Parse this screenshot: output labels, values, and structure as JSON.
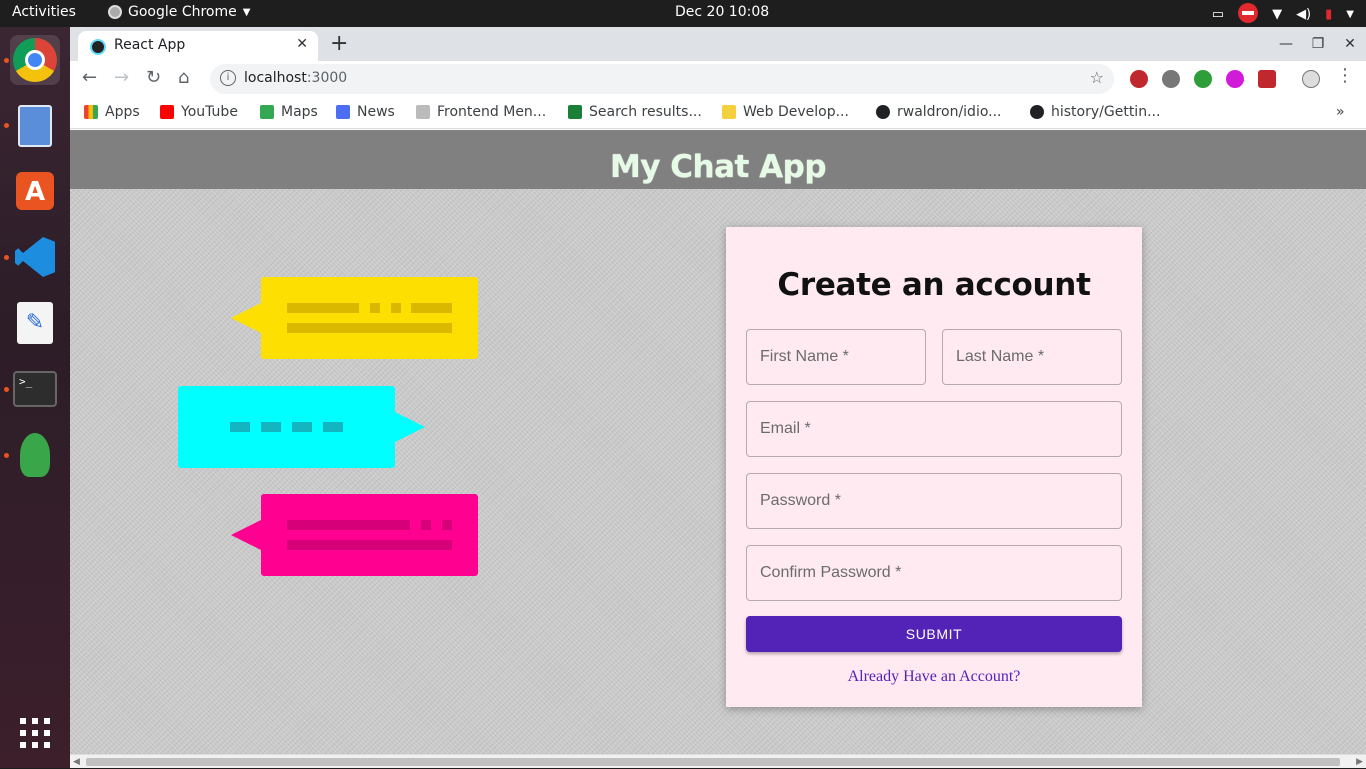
{
  "os": {
    "activities": "Activities",
    "app_name": "Google Chrome",
    "clock": "Dec 20  10:08"
  },
  "browser": {
    "tab_title": "React App",
    "url_host": "localhost",
    "url_port": ":3000",
    "bookmarks": [
      {
        "label": "Apps",
        "color": "#4285f4"
      },
      {
        "label": "YouTube",
        "color": "#ff0000"
      },
      {
        "label": "Maps",
        "color": "#34a853"
      },
      {
        "label": "News",
        "color": "#4c6ef5"
      },
      {
        "label": "Frontend Men...",
        "color": "#999999"
      },
      {
        "label": "Search results...",
        "color": "#1a7f37"
      },
      {
        "label": "Web Develop...",
        "color": "#8a6d00"
      },
      {
        "label": "rwaldron/idio...",
        "color": "#202124"
      },
      {
        "label": "history/Gettin...",
        "color": "#202124"
      }
    ]
  },
  "app": {
    "header_title": "My Chat App",
    "form_title": "Create an account",
    "fields": {
      "first_name": "First Name *",
      "last_name": "Last Name *",
      "email": "Email *",
      "password": "Password *",
      "confirm_password": "Confirm Password *"
    },
    "submit_label": "SUBMIT",
    "login_link": "Already Have an Account?"
  },
  "colors": {
    "header_bg": "#808080",
    "card_bg": "#ffeaf2",
    "primary": "#5323b8",
    "bubble_yellow": "#fde001",
    "bubble_cyan": "#00ffff",
    "bubble_pink": "#ff0090"
  }
}
